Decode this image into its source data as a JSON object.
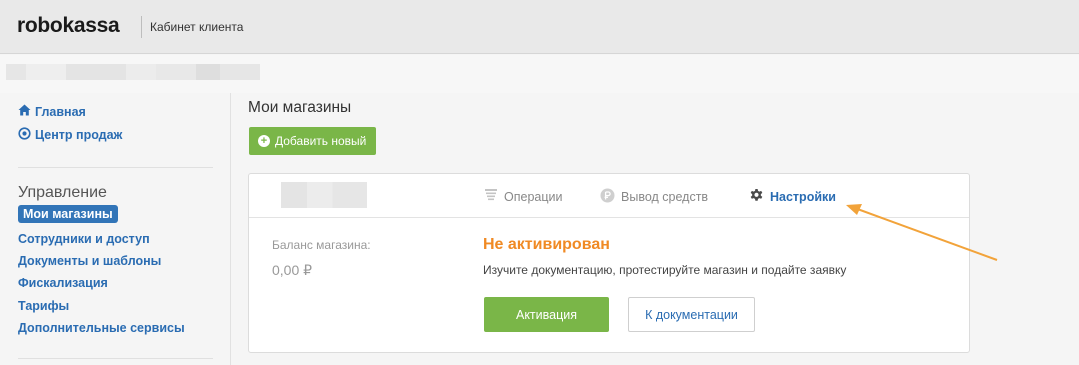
{
  "header": {
    "logo_text": "robokassa",
    "cabinet_label": "Кабинет клиента"
  },
  "sidebar": {
    "top_links": [
      {
        "label": "Главная",
        "icon": "home-icon"
      },
      {
        "label": "Центр продаж",
        "icon": "target-icon"
      }
    ],
    "section_title": "Управление",
    "links": [
      {
        "label": "Мои магазины",
        "active": true
      },
      {
        "label": "Сотрудники и доступ"
      },
      {
        "label": "Документы и шаблоны"
      },
      {
        "label": "Фискализация"
      },
      {
        "label": "Тарифы"
      },
      {
        "label": "Дополнительные сервисы"
      }
    ]
  },
  "main": {
    "title": "Мои магазины",
    "add_button_label": "Добавить новый",
    "card": {
      "tabs": [
        {
          "label": "Операции",
          "icon": "list-icon"
        },
        {
          "label": "Вывод средств",
          "icon": "ruble-circle-icon"
        },
        {
          "label": "Настройки",
          "icon": "gear-icon",
          "active": true
        }
      ],
      "balance_label": "Баланс магазина:",
      "balance_value": "0,00 ₽",
      "status_title": "Не активирован",
      "status_description": "Изучите документацию, протестируйте магазин и подайте заявку",
      "activate_button_label": "Активация",
      "docs_button_label": "К документации"
    }
  },
  "colors": {
    "accent_green": "#7ab648",
    "link_blue": "#2a6cb2",
    "status_orange": "#f08a24",
    "annotation_arrow": "#f2a33a"
  }
}
